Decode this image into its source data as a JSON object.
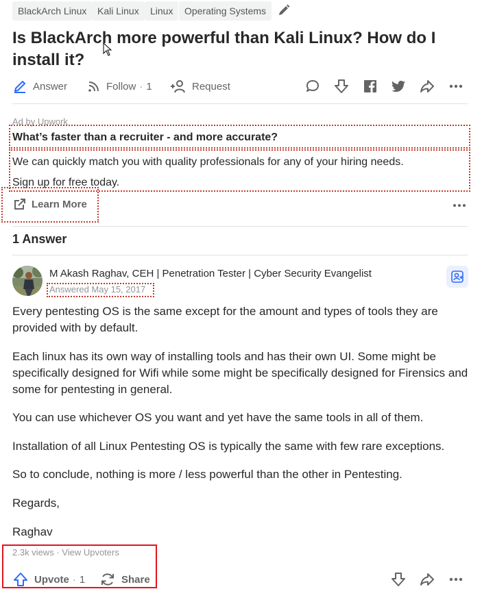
{
  "topics": [
    "BlackArch Linux",
    "Kali Linux",
    "Linux",
    "Operating Systems"
  ],
  "question": {
    "title": "Is BlackArch more powerful than Kali Linux? How do I install it?",
    "answer_label": "Answer",
    "follow_label": "Follow",
    "follow_count": "1",
    "request_label": "Request"
  },
  "ad": {
    "by": "Ad by Upwork",
    "title": "What’s faster than a recruiter - and more accurate?",
    "body_line1": "We can quickly match you with quality professionals for any of your hiring needs.",
    "body_line2": "Sign up for free today.",
    "cta": "Learn More"
  },
  "answers_header": "1 Answer",
  "answer": {
    "author_name": "M Akash Raghav, CEH",
    "author_credential": " | Penetration Tester | Cyber Security Evangelist",
    "date": "Answered May 15, 2017",
    "paragraphs": [
      "Every pentesting OS is the same except for the amount and types of tools they are provided with by default.",
      "Each linux has its own way of installing tools and has their own UI. Some might be specifically designed for Wifi while some might be specifically designed for Firensics and some for pentesting in general.",
      "You can use whichever OS you want and yet have the same tools in all of them.",
      "Installation of all Linux Pentesting OS is typically the same with few rare exceptions.",
      "So to conclude, nothing is more / less powerful than the other in Pentesting.",
      "Regards,",
      "Raghav"
    ],
    "views": "2.3k views",
    "view_upvoters": "View Upvoters",
    "upvote_label": "Upvote",
    "upvote_count": "1",
    "share_label": "Share"
  },
  "colors": {
    "accent_blue": "#2e69ff",
    "annotation_red": "#e0141e",
    "text": "#282829",
    "muted": "#636466"
  }
}
